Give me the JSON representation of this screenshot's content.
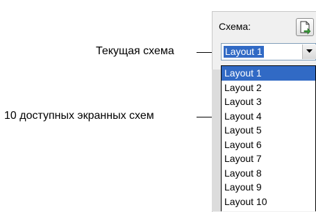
{
  "callouts": {
    "current": "Текущая схема",
    "available": "10 доступных экранных схем"
  },
  "panel": {
    "scheme_label": "Схема:",
    "tool_button_icon": "copy-layout-icon"
  },
  "combo": {
    "value": "Layout 1",
    "arrow_icon": "chevron-down-icon"
  },
  "dropdown": {
    "selected_index": 0,
    "items": [
      "Layout 1",
      "Layout 2",
      "Layout 3",
      "Layout 4",
      "Layout 5",
      "Layout 6",
      "Layout 7",
      "Layout 8",
      "Layout 9",
      "Layout 10"
    ]
  },
  "colors": {
    "selection": "#316ac5",
    "border": "#7f9db9"
  }
}
